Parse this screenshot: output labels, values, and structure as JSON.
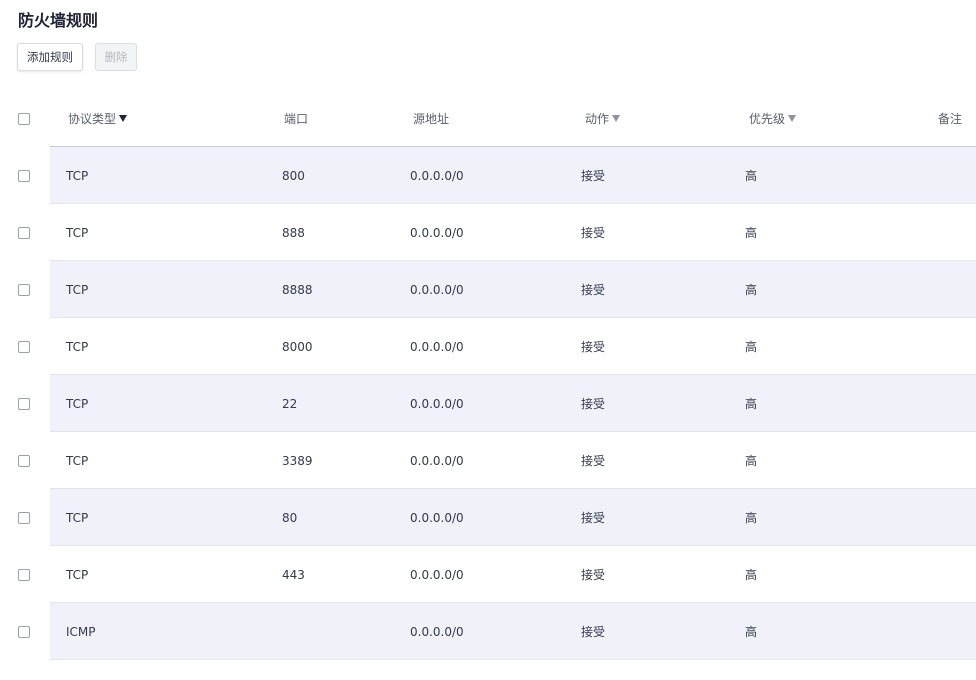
{
  "page": {
    "title": "防火墙规则"
  },
  "toolbar": {
    "add_label": "添加规则",
    "delete_label": "删除"
  },
  "table": {
    "columns": {
      "protocol": "协议类型",
      "port": "端口",
      "source": "源地址",
      "action": "动作",
      "priority": "优先级",
      "note": "备注"
    },
    "rows": [
      {
        "protocol": "TCP",
        "port": "800",
        "source": "0.0.0.0/0",
        "action": "接受",
        "priority": "高",
        "note": ""
      },
      {
        "protocol": "TCP",
        "port": "888",
        "source": "0.0.0.0/0",
        "action": "接受",
        "priority": "高",
        "note": ""
      },
      {
        "protocol": "TCP",
        "port": "8888",
        "source": "0.0.0.0/0",
        "action": "接受",
        "priority": "高",
        "note": ""
      },
      {
        "protocol": "TCP",
        "port": "8000",
        "source": "0.0.0.0/0",
        "action": "接受",
        "priority": "高",
        "note": ""
      },
      {
        "protocol": "TCP",
        "port": "22",
        "source": "0.0.0.0/0",
        "action": "接受",
        "priority": "高",
        "note": ""
      },
      {
        "protocol": "TCP",
        "port": "3389",
        "source": "0.0.0.0/0",
        "action": "接受",
        "priority": "高",
        "note": ""
      },
      {
        "protocol": "TCP",
        "port": "80",
        "source": "0.0.0.0/0",
        "action": "接受",
        "priority": "高",
        "note": ""
      },
      {
        "protocol": "TCP",
        "port": "443",
        "source": "0.0.0.0/0",
        "action": "接受",
        "priority": "高",
        "note": ""
      },
      {
        "protocol": "ICMP",
        "port": "",
        "source": "0.0.0.0/0",
        "action": "接受",
        "priority": "高",
        "note": ""
      }
    ]
  },
  "icons": {
    "filter": "filter-icon",
    "checkbox": "checkbox"
  },
  "colors": {
    "row_alt_bg": "#f0f1f9",
    "header_border": "#c9ccd8",
    "text": "#333a4d",
    "title": "#1f2436"
  }
}
